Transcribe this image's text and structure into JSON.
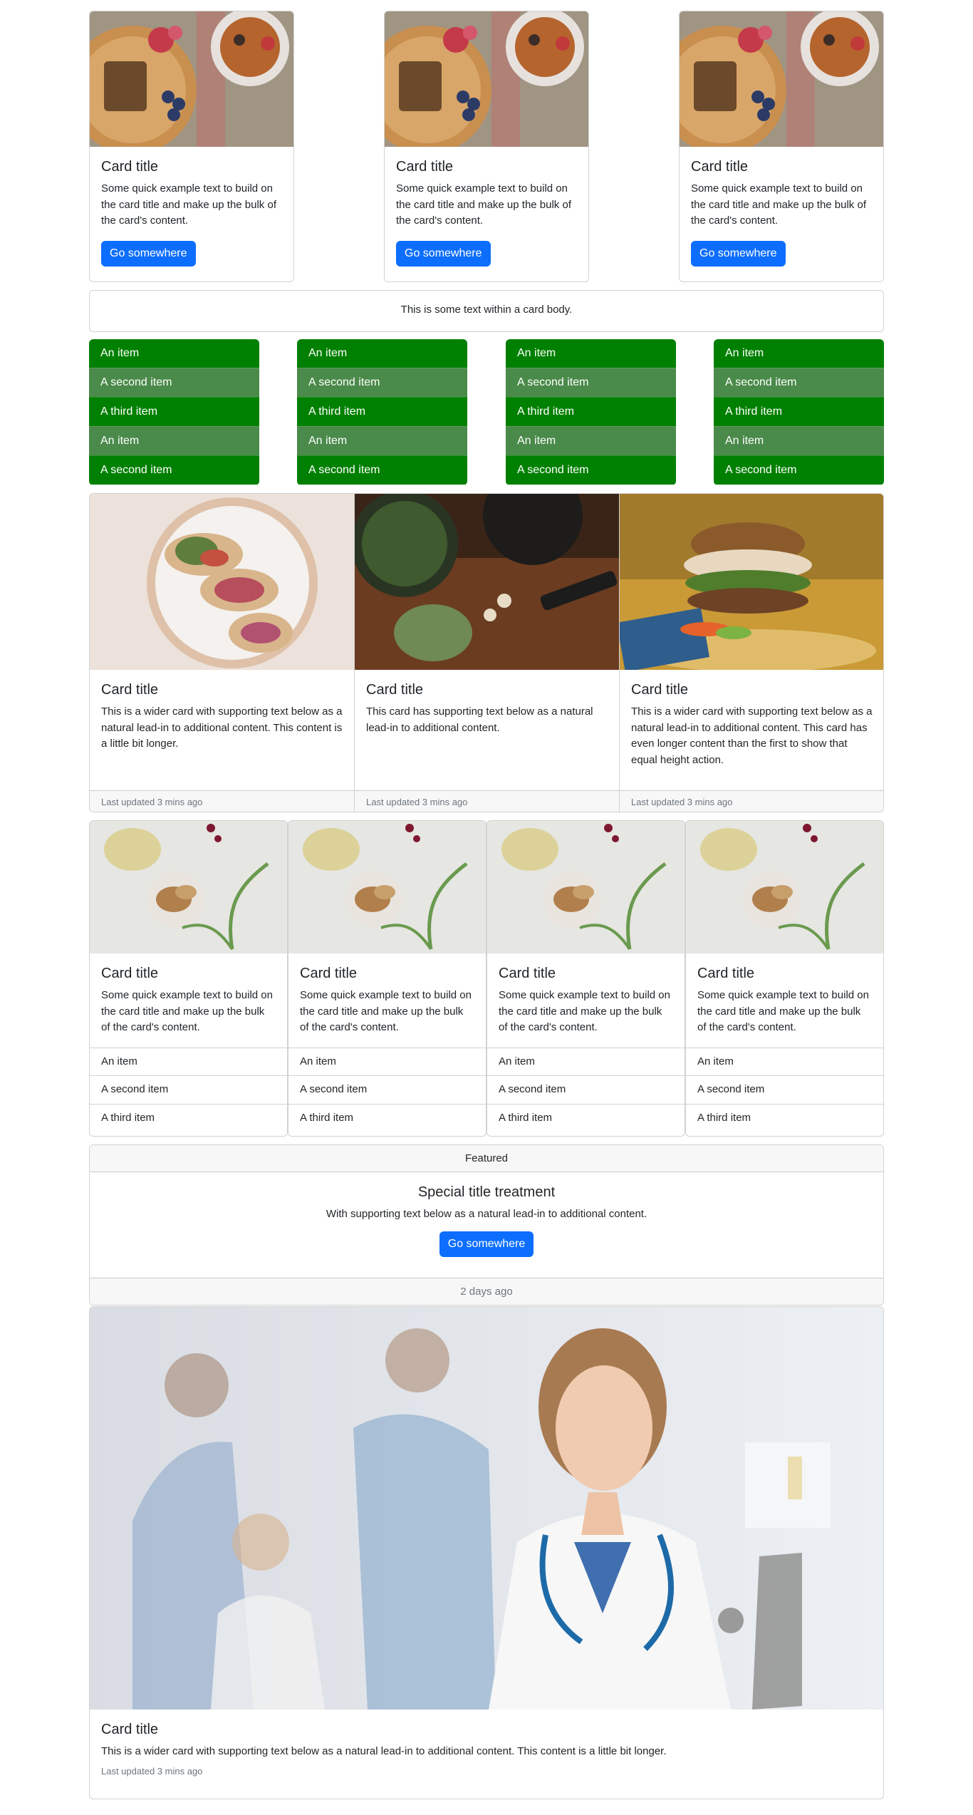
{
  "colors": {
    "primary_button": "#0d6efd",
    "list_green_dark": "#008000",
    "list_green_light": "#4a8a4a",
    "footer_bg": "#f7f7f7"
  },
  "row1": {
    "cards": [
      {
        "title": "Card title",
        "text": "Some quick example text to build on the card title and make up the bulk of the card's content.",
        "button": "Go somewhere"
      },
      {
        "title": "Card title",
        "text": "Some quick example text to build on the card title and make up the bulk of the card's content.",
        "button": "Go somewhere"
      },
      {
        "title": "Card title",
        "text": "Some quick example text to build on the card title and make up the bulk of the card's content.",
        "button": "Go somewhere"
      }
    ]
  },
  "body_card": {
    "text": "This is some text within a card body."
  },
  "lists": [
    {
      "items": [
        "An item",
        "A second item",
        "A third item",
        "An item",
        "A second item"
      ]
    },
    {
      "items": [
        "An item",
        "A second item",
        "A third item",
        "An item",
        "A second item"
      ]
    },
    {
      "items": [
        "An item",
        "A second item",
        "A third item",
        "An item",
        "A second item"
      ]
    },
    {
      "items": [
        "An item",
        "A second item",
        "A third item",
        "An item",
        "A second item"
      ]
    }
  ],
  "group": {
    "cards": [
      {
        "title": "Card title",
        "text": "This is a wider card with supporting text below as a natural lead-in to additional content. This content is a little bit longer.",
        "footer": "Last updated 3 mins ago"
      },
      {
        "title": "Card title",
        "text": "This card has supporting text below as a natural lead-in to additional content.",
        "footer": "Last updated 3 mins ago"
      },
      {
        "title": "Card title",
        "text": "This is a wider card with supporting text below as a natural lead-in to additional content. This card has even longer content than the first to show that equal height action.",
        "footer": "Last updated 3 mins ago"
      }
    ]
  },
  "row4": {
    "cards": [
      {
        "title": "Card title",
        "text": "Some quick example text to build on the card title and make up the bulk of the card's content.",
        "items": [
          "An item",
          "A second item",
          "A third item"
        ]
      },
      {
        "title": "Card title",
        "text": "Some quick example text to build on the card title and make up the bulk of the card's content.",
        "items": [
          "An item",
          "A second item",
          "A third item"
        ]
      },
      {
        "title": "Card title",
        "text": "Some quick example text to build on the card title and make up the bulk of the card's content.",
        "items": [
          "An item",
          "A second item",
          "A third item"
        ]
      },
      {
        "title": "Card title",
        "text": "Some quick example text to build on the card title and make up the bulk of the card's content.",
        "items": [
          "An item",
          "A second item",
          "A third item"
        ]
      }
    ]
  },
  "featured": {
    "header": "Featured",
    "title": "Special title treatment",
    "text": "With supporting text below as a natural lead-in to additional content.",
    "button": "Go somewhere",
    "footer": "2 days ago"
  },
  "big_card": {
    "title": "Card title",
    "text": "This is a wider card with supporting text below as a natural lead-in to additional content. This content is a little bit longer.",
    "small": "Last updated 3 mins ago"
  }
}
